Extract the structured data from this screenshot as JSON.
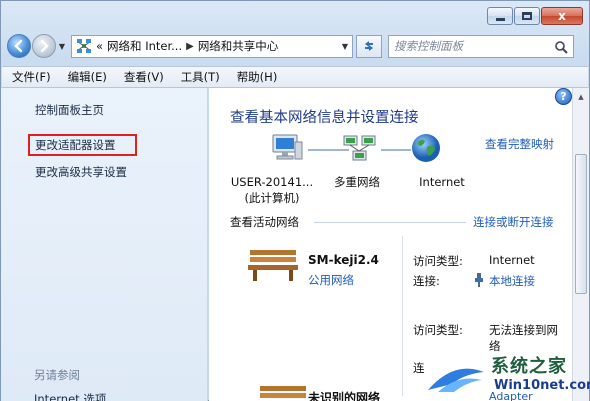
{
  "window": {
    "close_glyph": "x"
  },
  "nav": {
    "breadcrumb": [
      "«",
      "网络和 Inter...",
      "网络和共享中心"
    ],
    "search_placeholder": "搜索控制面板"
  },
  "menu": [
    "文件(F)",
    "编辑(E)",
    "查看(V)",
    "工具(T)",
    "帮助(H)"
  ],
  "sidebar": {
    "items": [
      "控制面板主页",
      "更改适配器设置",
      "更改高级共享设置"
    ],
    "highlighted_index": 1,
    "see_also": "另请参阅",
    "bottom_item": "Internet 选项",
    "highlight_color": "#e02020"
  },
  "main": {
    "help_glyph": "?",
    "title": "查看基本网络信息并设置连接",
    "full_map_link": "查看完整映射",
    "nodes": [
      {
        "label_line1": "USER-20141...",
        "label_line2": "(此计算机)",
        "icon": "computer-icon"
      },
      {
        "label_line1": "多重网络",
        "label_line2": "",
        "icon": "network-icon"
      },
      {
        "label_line1": "Internet",
        "label_line2": "",
        "icon": "globe-icon"
      }
    ],
    "active_networks_label": "查看活动网络",
    "connect_link": "连接或断开连接",
    "networks": [
      {
        "name": "SM-keji2.4",
        "type": "公用网络",
        "access_type_label": "访问类型:",
        "access_type_value": "Internet",
        "connection_label": "连接:",
        "connection_value": "本地连接"
      },
      {
        "name": "未识别的网络",
        "type": "",
        "access_type_label": "访问类型:",
        "access_type_value": "无法连接到网络",
        "connection_label": "连",
        "connection_value": "Adapter"
      }
    ]
  },
  "watermark": {
    "title": "系统之家",
    "url": "Win10net.com"
  },
  "colors": {
    "link": "#1f5dbb",
    "title": "#1e3a8a"
  }
}
